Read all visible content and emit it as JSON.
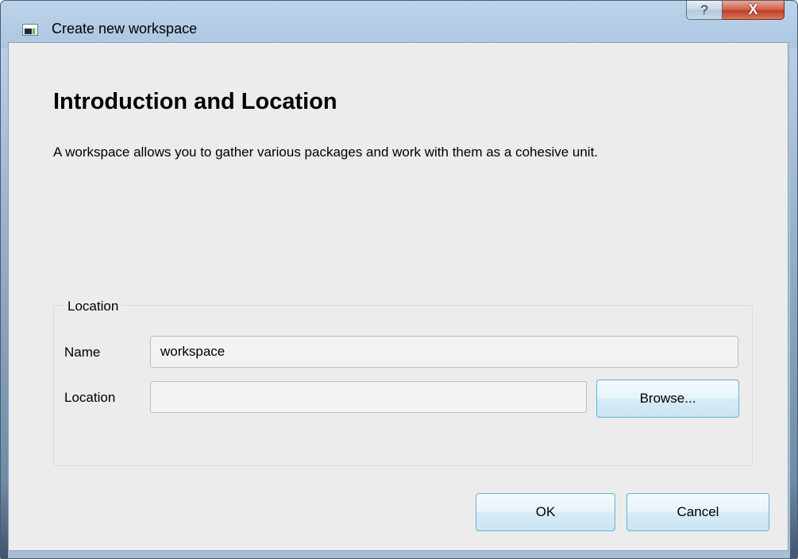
{
  "window": {
    "title": "Create new workspace",
    "help_symbol": "?",
    "close_symbol": "X"
  },
  "page": {
    "heading": "Introduction and Location",
    "description": "A workspace allows you to gather various packages and work with them as a cohesive unit."
  },
  "location_group": {
    "title": "Location",
    "name_label": "Name",
    "name_value": "workspace",
    "location_label": "Location",
    "location_value": "",
    "browse_label": "Browse..."
  },
  "buttons": {
    "ok_label": "OK",
    "cancel_label": "Cancel"
  },
  "icons": {
    "app": "app-window-icon",
    "help": "help-icon",
    "close": "close-icon"
  }
}
